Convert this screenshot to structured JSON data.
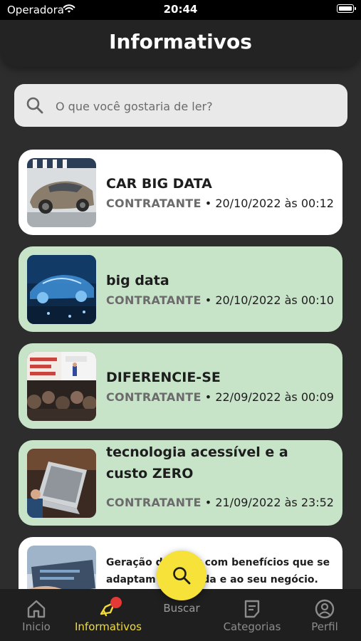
{
  "status_bar": {
    "carrier": "Operadora",
    "time": "20:44"
  },
  "header": {
    "title": "Informativos"
  },
  "search": {
    "placeholder": "O que você gostaria de ler?"
  },
  "articles": [
    {
      "title": "CAR BIG DATA",
      "author": "CONTRATANTE",
      "date": "• 20/10/2022 às 00:12",
      "background": "#ffffff"
    },
    {
      "title": "big data",
      "author": "CONTRATANTE",
      "date": "• 20/10/2022 às 00:10",
      "background": "#c7e4c9"
    },
    {
      "title": "DIFERENCIE-SE",
      "author": "CONTRATANTE",
      "date": "• 22/09/2022 às 00:09",
      "background": "#c7e4c9"
    },
    {
      "title": "tecnologia acessível e a custo ZERO",
      "author": "CONTRATANTE",
      "date": "• 21/09/2022 às 23:52",
      "background": "#c7e4c9"
    },
    {
      "title": "Geração de valor com benefícios que se adaptam a sua vida e ao seu negócio.",
      "background": "#ffffff"
    }
  ],
  "tabs": [
    {
      "label": "Inicio",
      "icon": "home-icon"
    },
    {
      "label": "Informativos",
      "icon": "megaphone-icon",
      "active": true
    },
    {
      "label": "Buscar",
      "icon": "search-icon"
    },
    {
      "label": "Categorias",
      "icon": "note-icon"
    },
    {
      "label": "Perfil",
      "icon": "user-circle-icon"
    }
  ],
  "colors": {
    "accent": "#f6e239",
    "card_green": "#c7e4c9",
    "badge": "#e53935",
    "background": "#2d2d2d"
  }
}
